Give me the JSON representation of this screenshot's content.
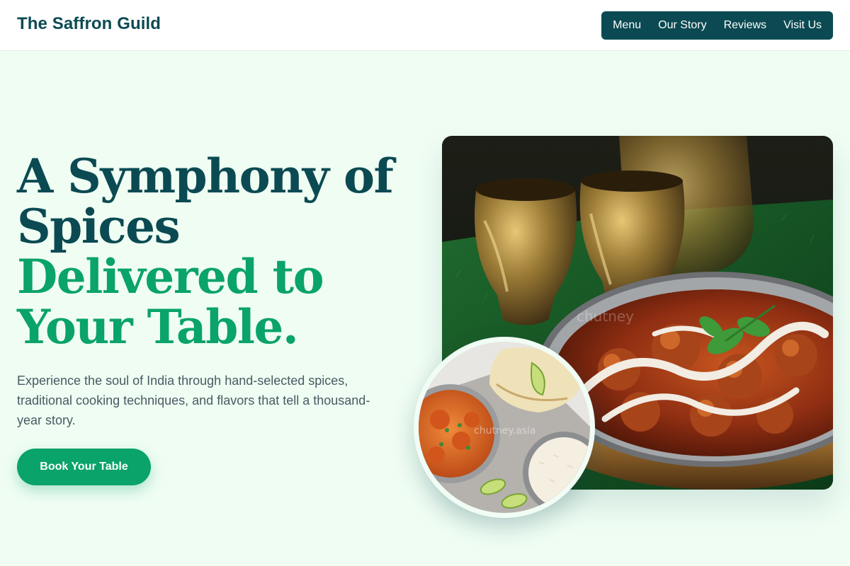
{
  "header": {
    "brand": "The Saffron Guild",
    "nav": [
      "Menu",
      "Our Story",
      "Reviews",
      "Visit Us"
    ]
  },
  "hero": {
    "title_line1": "A Symphony of",
    "title_line2": "Spices",
    "title_line3": "Delivered to",
    "title_line4": "Your Table.",
    "description": "Experience the soul of India through hand-selected spices, traditional cooking techniques, and flavors that tell a thousand-year story.",
    "cta_label": "Book Your Table"
  },
  "images": {
    "main_watermark": "chutney",
    "round_watermark": "chutney.asia"
  },
  "colors": {
    "brand_dark": "#0b4a52",
    "brand_green": "#0aa36a",
    "page_bg": "#effdf3"
  }
}
